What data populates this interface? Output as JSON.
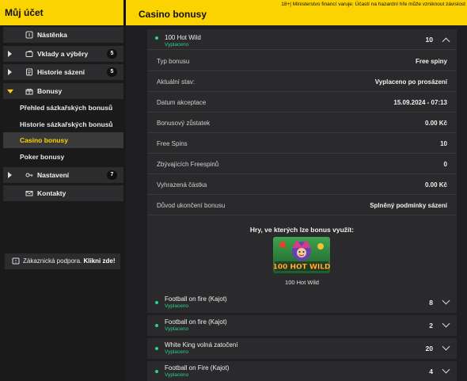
{
  "header": {
    "account_title": "Můj účet",
    "page_title": "Casino bonusy",
    "warning": "18+| Ministerstvo financí varuje: Účastí na hazardní hře může vzniknout závislost"
  },
  "sidebar": {
    "items": [
      {
        "label": "Nástěnka",
        "icon": "dashboard-icon"
      },
      {
        "label": "Vklady a výběry",
        "icon": "wallet-icon",
        "badge": "5"
      },
      {
        "label": "Historie sázení",
        "icon": "history-icon",
        "badge": "5"
      },
      {
        "label": "Bonusy",
        "icon": "gift-icon"
      },
      {
        "label": "Nastavení",
        "icon": "key-icon",
        "badge": "7"
      },
      {
        "label": "Kontakty",
        "icon": "mail-icon"
      }
    ],
    "bonus_sub": [
      {
        "label": "Přehled sázkařských bonusů"
      },
      {
        "label": "Historie sázkařských bonusů"
      },
      {
        "label": "Casino bonusy"
      },
      {
        "label": "Poker bonusy"
      }
    ],
    "support_text": "Zákaznická podpora.",
    "support_link": "Klikni zde!"
  },
  "expanded": {
    "title": "100 Hot Wild",
    "status": "Vyplaceno",
    "count": "10",
    "rows": [
      {
        "k": "Typ bonusu",
        "v": "Free spiny"
      },
      {
        "k": "Aktuální stav:",
        "v": "Vyplaceno po prosázení"
      },
      {
        "k": "Datum akceptace",
        "v": "15.09.2024 - 07:13"
      },
      {
        "k": "Bonusový zůstatek",
        "v": "0.00 Kč"
      },
      {
        "k": "Free Spins",
        "v": "10"
      },
      {
        "k": "Zbývajících Freespinů",
        "v": "0"
      },
      {
        "k": "Vyhrazená částka",
        "v": "0.00 Kč"
      },
      {
        "k": "Důvod ukončení bonusu",
        "v": "Splněný podmínky sázení"
      }
    ],
    "games_title": "Hry, ve kterých lze bonus využít:",
    "game_name": "100 Hot Wild",
    "game_logo_text": "100 HOT WILD"
  },
  "bonuses": [
    {
      "title": "Football on fire (Kajot)",
      "status": "Vyplaceno",
      "count": "8"
    },
    {
      "title": "Football on fire (Kajot)",
      "status": "Vyplaceno",
      "count": "2"
    },
    {
      "title": "White King volná zatočení",
      "status": "Vyplaceno",
      "count": "20"
    },
    {
      "title": "Football on Fire (Kajot)",
      "status": "Vyplaceno",
      "count": "4"
    }
  ],
  "colors": {
    "accent": "#fbd300",
    "status_green": "#2bd08a",
    "bg": "#1f1f21",
    "card": "#2a2a2c"
  }
}
